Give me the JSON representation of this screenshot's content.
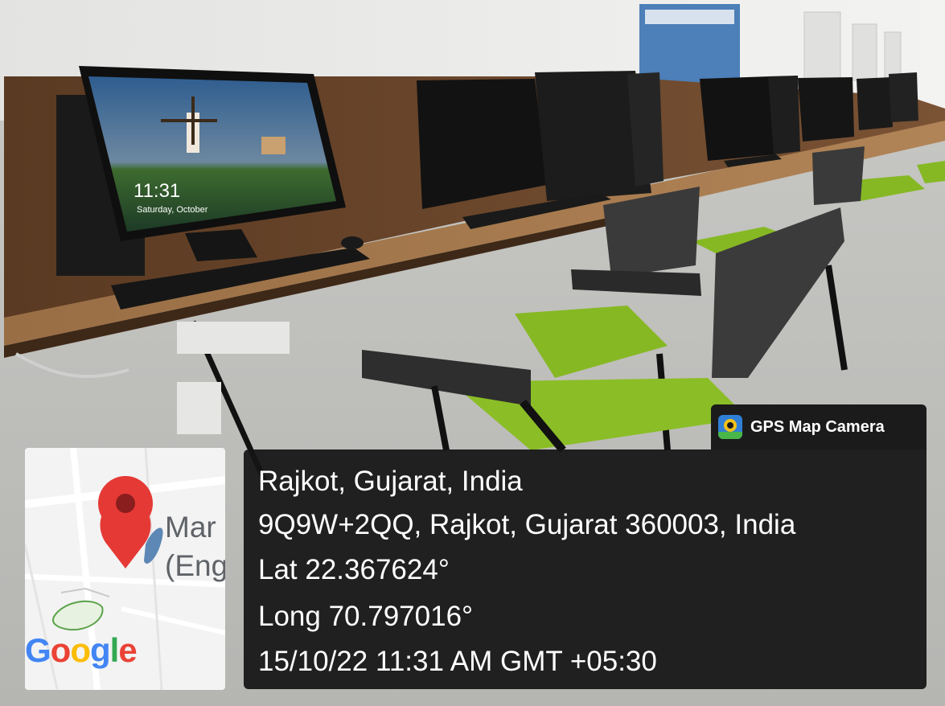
{
  "photo": {
    "monitor_clock": {
      "time": "11:31",
      "date": "Saturday, October"
    }
  },
  "gps_overlay": {
    "app_badge": {
      "label": "GPS Map Camera",
      "icon": "gps-map-camera-icon"
    },
    "location_title": "Rajkot, Gujarat, India",
    "address": "9Q9W+2QQ, Rajkot, Gujarat 360003, India",
    "latitude": "Lat 22.367624°",
    "longitude": "Long 70.797016°",
    "datetime": "15/10/22 11:31 AM GMT +05:30",
    "map": {
      "place_line1": "Mar",
      "place_line2": "(Eng",
      "pin_icon": "map-pin-icon",
      "logo_text": "Google",
      "logo_letters": [
        {
          "ch": "G",
          "color": "#4285F4"
        },
        {
          "ch": "o",
          "color": "#EA4335"
        },
        {
          "ch": "o",
          "color": "#FBBC05"
        },
        {
          "ch": "g",
          "color": "#4285F4"
        },
        {
          "ch": "l",
          "color": "#34A853"
        },
        {
          "ch": "e",
          "color": "#EA4335"
        }
      ]
    },
    "colors": {
      "panel_bg": "#141414",
      "text": "#ffffff",
      "pin": "#e53935"
    }
  }
}
